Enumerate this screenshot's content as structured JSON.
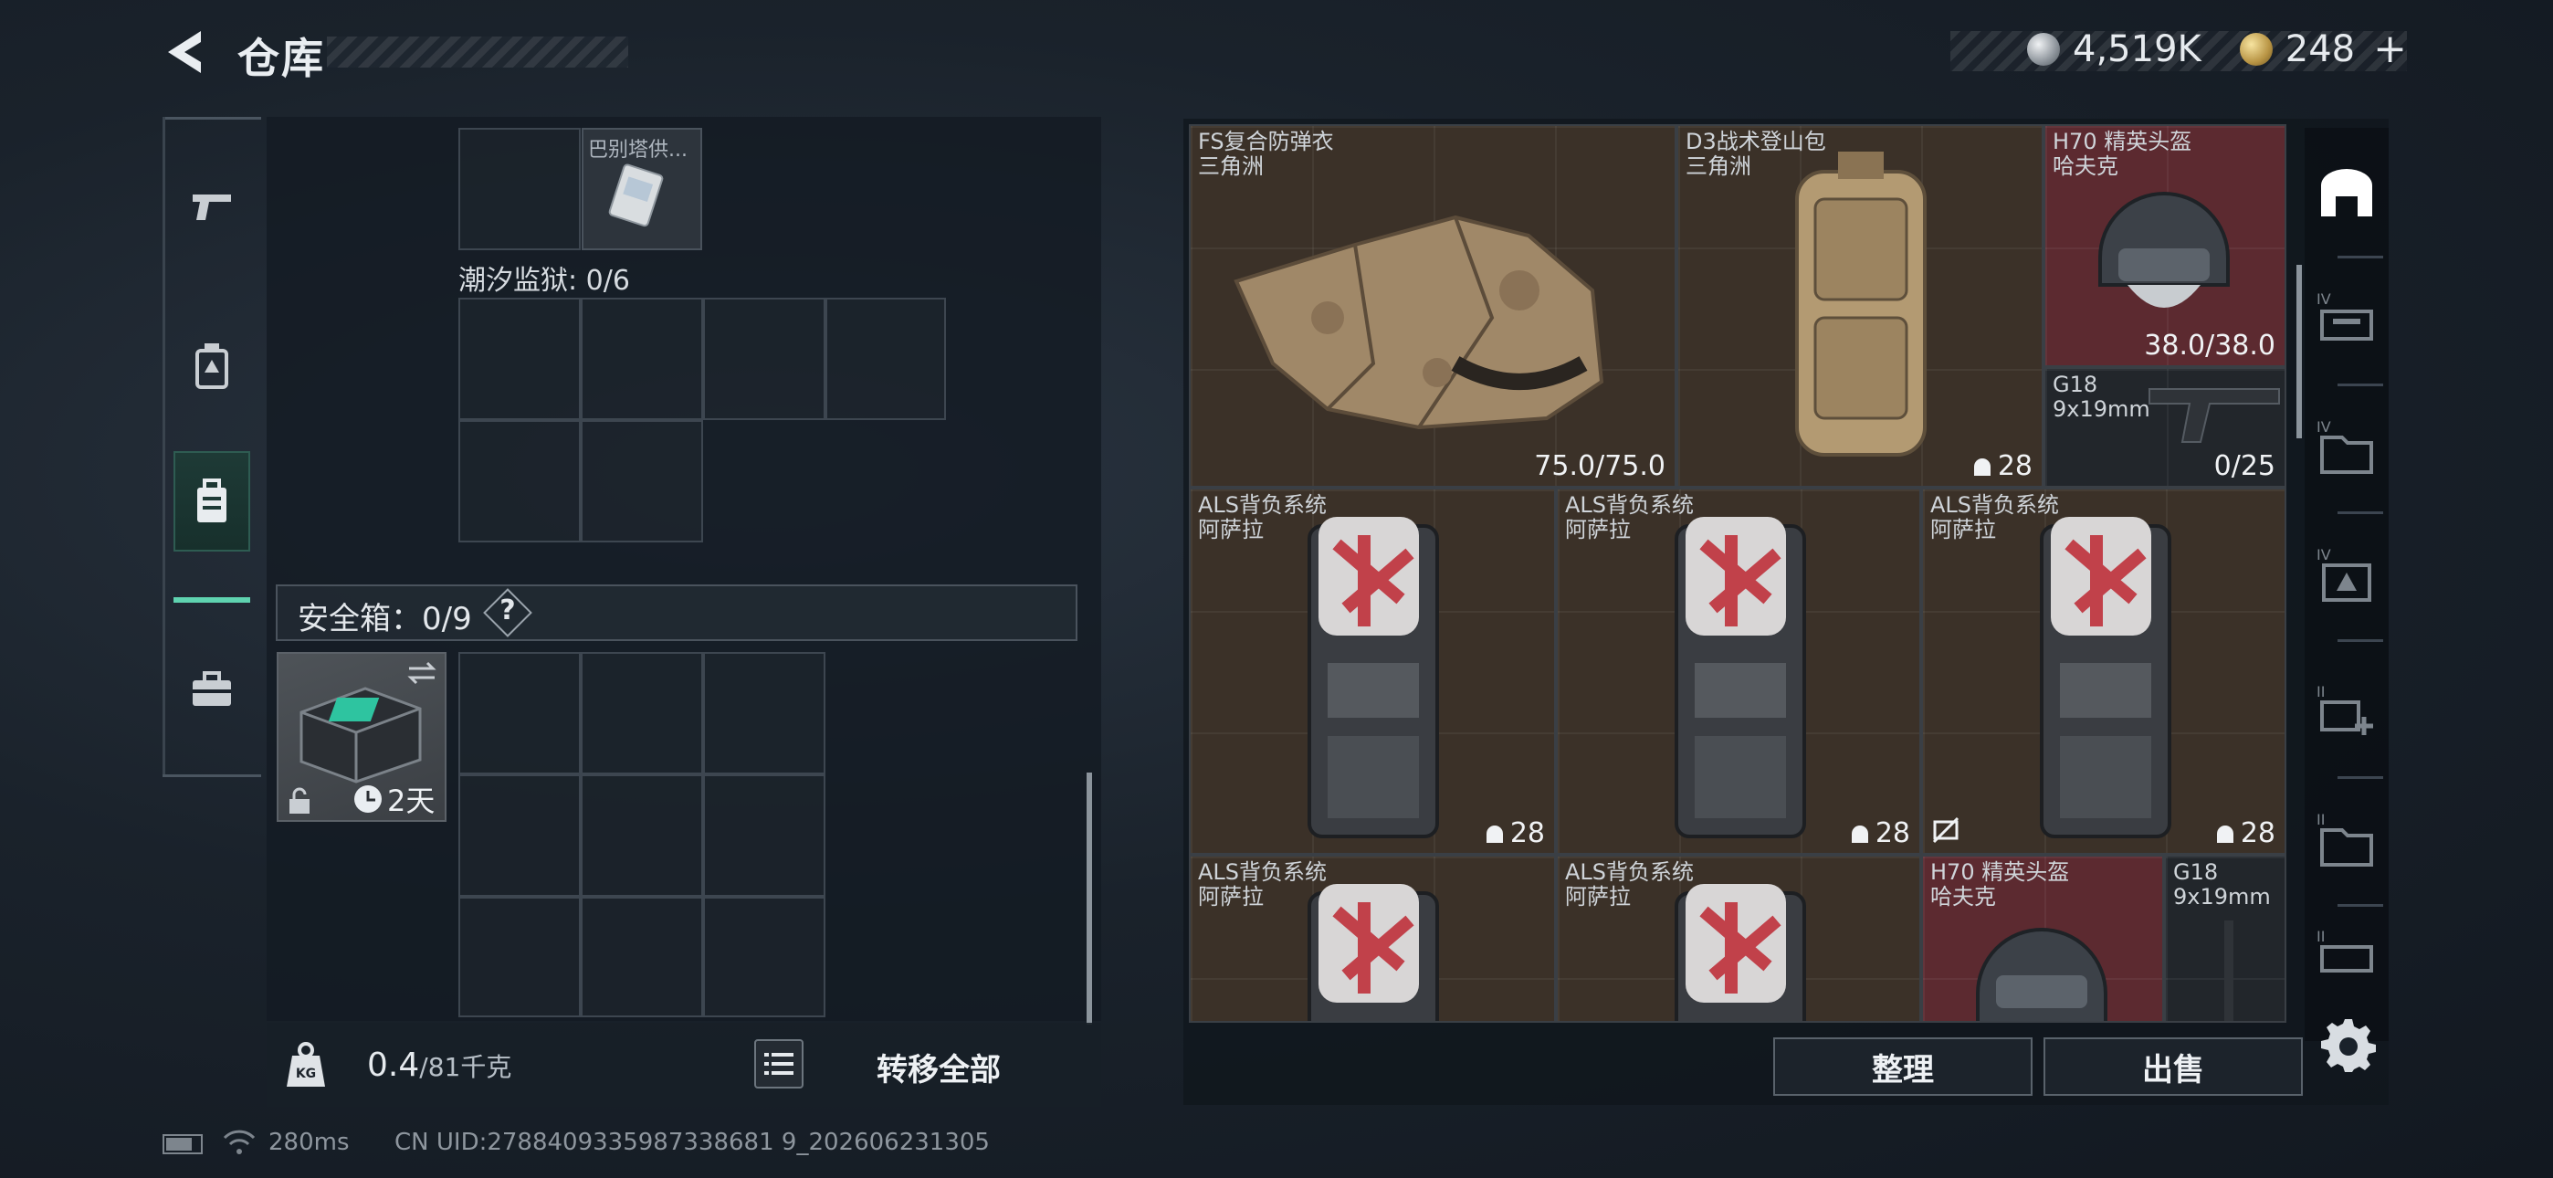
{
  "header": {
    "title": "仓库",
    "currency": [
      {
        "icon": "silver-coin-icon",
        "value": "4,519K"
      },
      {
        "icon": "gold-coin-icon",
        "value": "248"
      }
    ],
    "plus_label": "+"
  },
  "nav": {
    "items": [
      {
        "icon": "pistol-icon",
        "active": false
      },
      {
        "icon": "chest-rig-icon",
        "active": false
      },
      {
        "icon": "backpack-icon",
        "active": true
      },
      {
        "icon": "briefcase-icon",
        "active": false
      }
    ]
  },
  "left": {
    "tiny_item_label": "巴别塔供...",
    "tide_prison_label": "潮汐监狱: 0/6",
    "safe_label": "安全箱：0/9",
    "help_label": "?",
    "safe_box_timer": "2天",
    "weight_value": "0.4",
    "weight_unit": "/81千克",
    "transfer_all": "转移全部"
  },
  "items": [
    {
      "name": "FS复合防弹衣",
      "sub": "三角洲",
      "value": "75.0/75.0"
    },
    {
      "name": "D3战术登山包",
      "sub": "三角洲",
      "value": "28"
    },
    {
      "name": "H70 精英头盔",
      "sub": "哈夫克",
      "value": "38.0/38.0"
    },
    {
      "name": "G18",
      "sub": "9x19mm",
      "value": "0/25"
    },
    {
      "name": "ALS背负系统",
      "sub": "阿萨拉",
      "value": "28"
    },
    {
      "name": "ALS背负系统",
      "sub": "阿萨拉",
      "value": "28"
    },
    {
      "name": "ALS背负系统",
      "sub": "阿萨拉",
      "value": "28"
    },
    {
      "name": "ALS背负系统",
      "sub": "阿萨拉",
      "value": ""
    },
    {
      "name": "ALS背负系统",
      "sub": "阿萨拉",
      "value": ""
    },
    {
      "name": "H70 精英头盔",
      "sub": "哈夫克",
      "value": ""
    },
    {
      "name": "G18",
      "sub": "9x19mm",
      "value": ""
    }
  ],
  "filters": [
    "IV",
    "IV",
    "IV",
    "II",
    "II",
    "II"
  ],
  "actions": {
    "sort": "整理",
    "sell": "出售"
  },
  "footer": {
    "ping": "280ms",
    "uid": "CN UID:2788409335987338681 9_202606231305"
  }
}
